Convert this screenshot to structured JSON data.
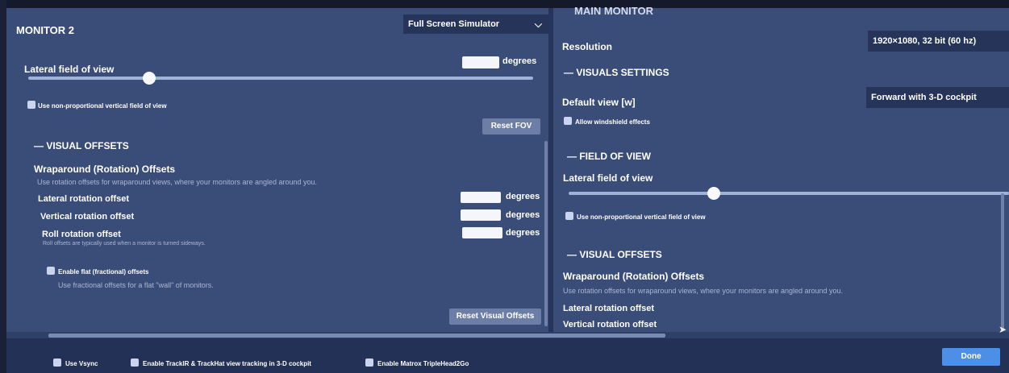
{
  "left": {
    "title": "MONITOR 2",
    "mode_dropdown": "Full Screen Simulator",
    "lateral_fov_label": "Lateral field of view",
    "fov_unit": "degrees",
    "nonprop_label": "Use non-proportional vertical field of view",
    "reset_fov": "Reset FOV",
    "visual_offsets_head": "— VISUAL OFFSETS",
    "wrap_title": "Wraparound (Rotation) Offsets",
    "wrap_desc": "Use rotation offsets for wraparound views, where your monitors are angled around you.",
    "lateral_rot": "Lateral rotation offset",
    "vertical_rot": "Vertical rotation offset",
    "roll_rot": "Roll rotation offset",
    "roll_desc": "Roll offsets are typically used when a monitor is turned sideways.",
    "unit": "degrees",
    "flat_label": "Enable flat (fractional) offsets",
    "flat_desc": "Use fractional offsets for a flat \"wall\" of monitors.",
    "reset_visual": "Reset Visual Offsets",
    "fov_slider_fraction": 0.24
  },
  "right": {
    "title": "MAIN MONITOR",
    "resolution_label": "Resolution",
    "resolution_value": "1920×1080, 32 bit (60 hz)",
    "visuals_head": "— VISUALS SETTINGS",
    "default_view_label": "Default view [w]",
    "default_view_value": "Forward with 3-D cockpit",
    "windshield_label": "Allow windshield effects",
    "fov_head": "— FIELD OF VIEW",
    "lateral_fov_label": "Lateral field of view",
    "nonprop_label": "Use non-proportional vertical field of view",
    "visual_offsets_head": "— VISUAL OFFSETS",
    "wrap_title": "Wraparound (Rotation) Offsets",
    "wrap_desc": "Use rotation offsets for wraparound views, where your monitors are angled around you.",
    "lateral_rot": "Lateral rotation offset",
    "vertical_rot": "Vertical rotation offset",
    "fov_slider_fraction": 0.33
  },
  "bottom": {
    "vsync": "Use Vsync",
    "trackir": "Enable TrackIR & TrackHat view tracking in 3-D cockpit",
    "matrox": "Enable Matrox TripleHead2Go",
    "done": "Done"
  },
  "icons": {
    "chevron": "chevron-down-icon"
  }
}
